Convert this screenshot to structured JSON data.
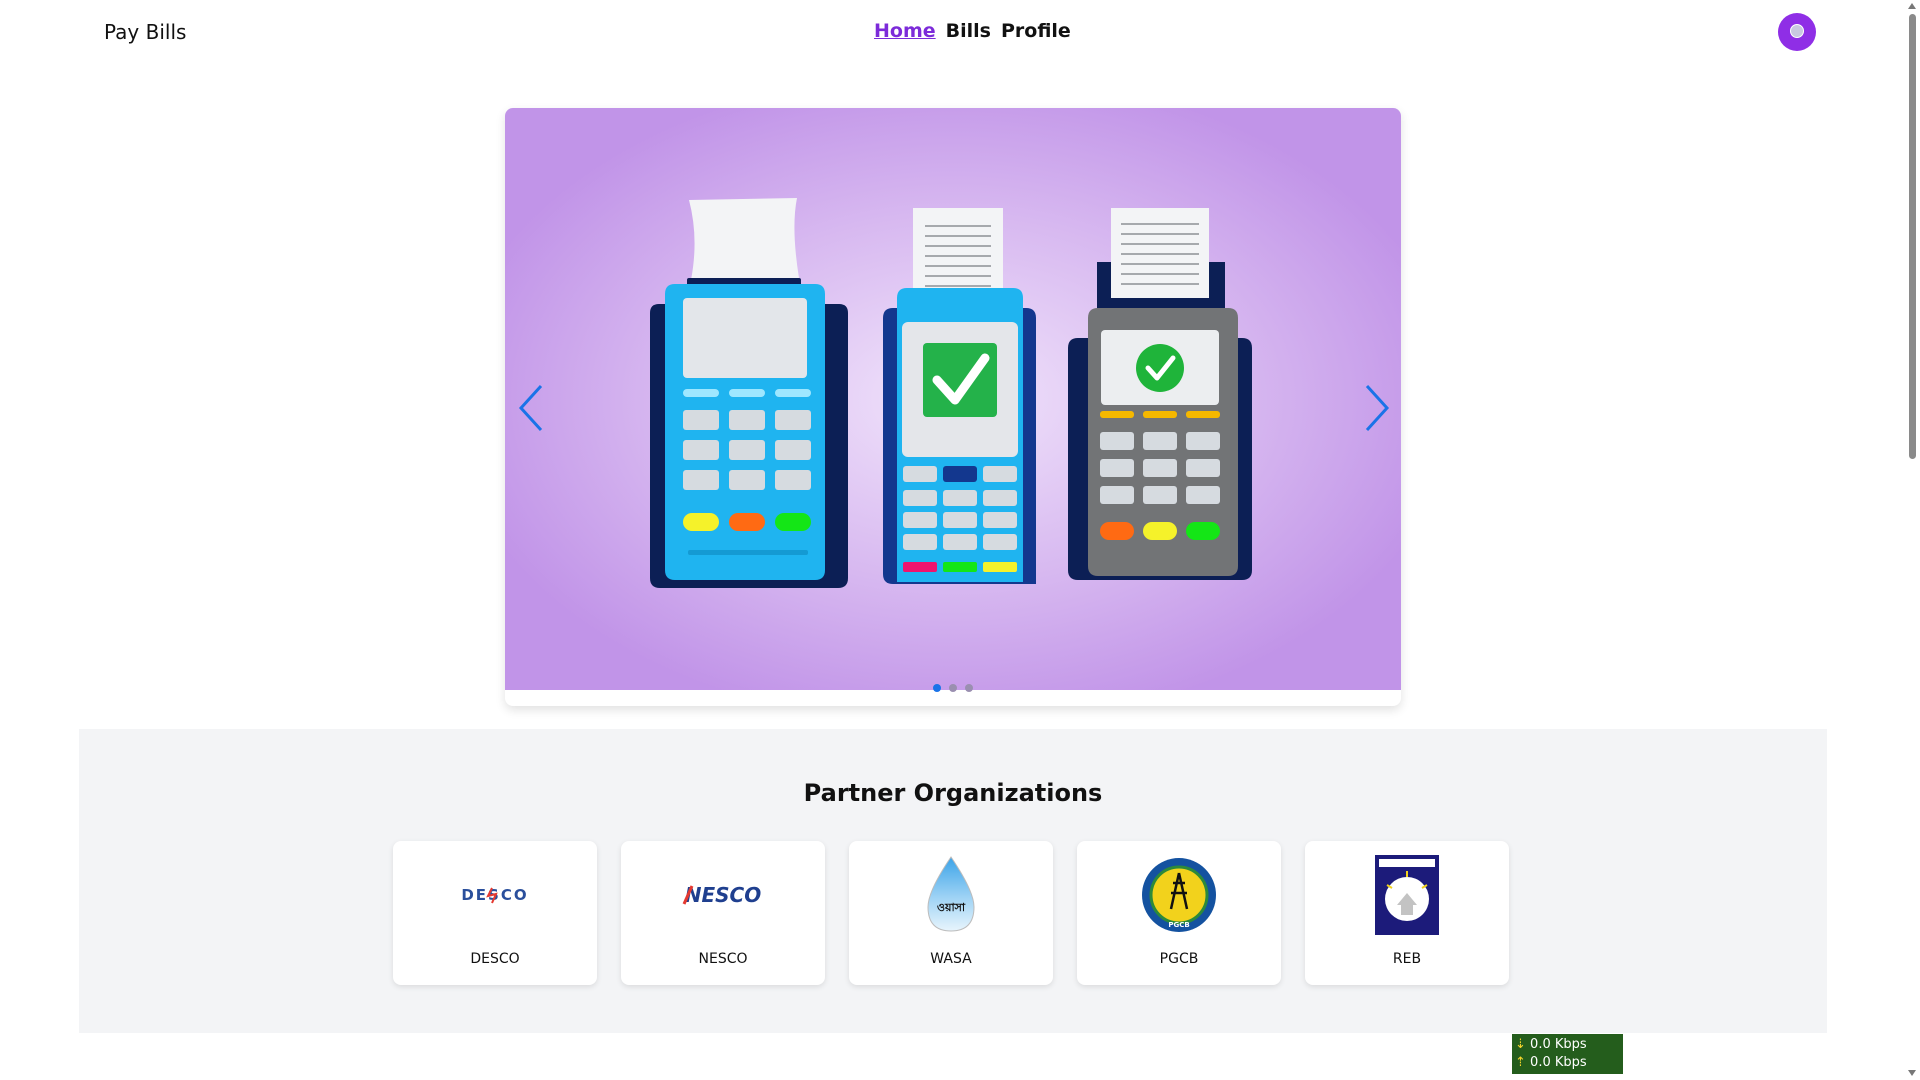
{
  "navbar": {
    "brand": "Pay Bills",
    "links": [
      {
        "label": "Home",
        "active": true
      },
      {
        "label": "Bills",
        "active": false
      },
      {
        "label": "Profile",
        "active": false
      }
    ],
    "avatar_icon": "user-avatar-icon"
  },
  "carousel": {
    "slide_count": 3,
    "active_slide": 1,
    "illustration": "payment-terminals-illustration",
    "prev_icon": "chevron-left-icon",
    "next_icon": "chevron-right-icon"
  },
  "partners": {
    "title": "Partner Organizations",
    "items": [
      {
        "name": "DESCO",
        "logo_text": "DESCO"
      },
      {
        "name": "NESCO",
        "logo_text": "NESCO"
      },
      {
        "name": "WASA",
        "logo_text": "ওয়াসা"
      },
      {
        "name": "PGCB",
        "logo_text": "PGCB"
      },
      {
        "name": "REB",
        "logo_text": ""
      }
    ]
  },
  "speed_meter": {
    "download": "0.0 Kbps",
    "upload": "0.0 Kbps"
  },
  "colors": {
    "accent": "#7c2bd9",
    "carousel_arrow": "#1a73e8",
    "speed_bg": "#245d1c"
  }
}
